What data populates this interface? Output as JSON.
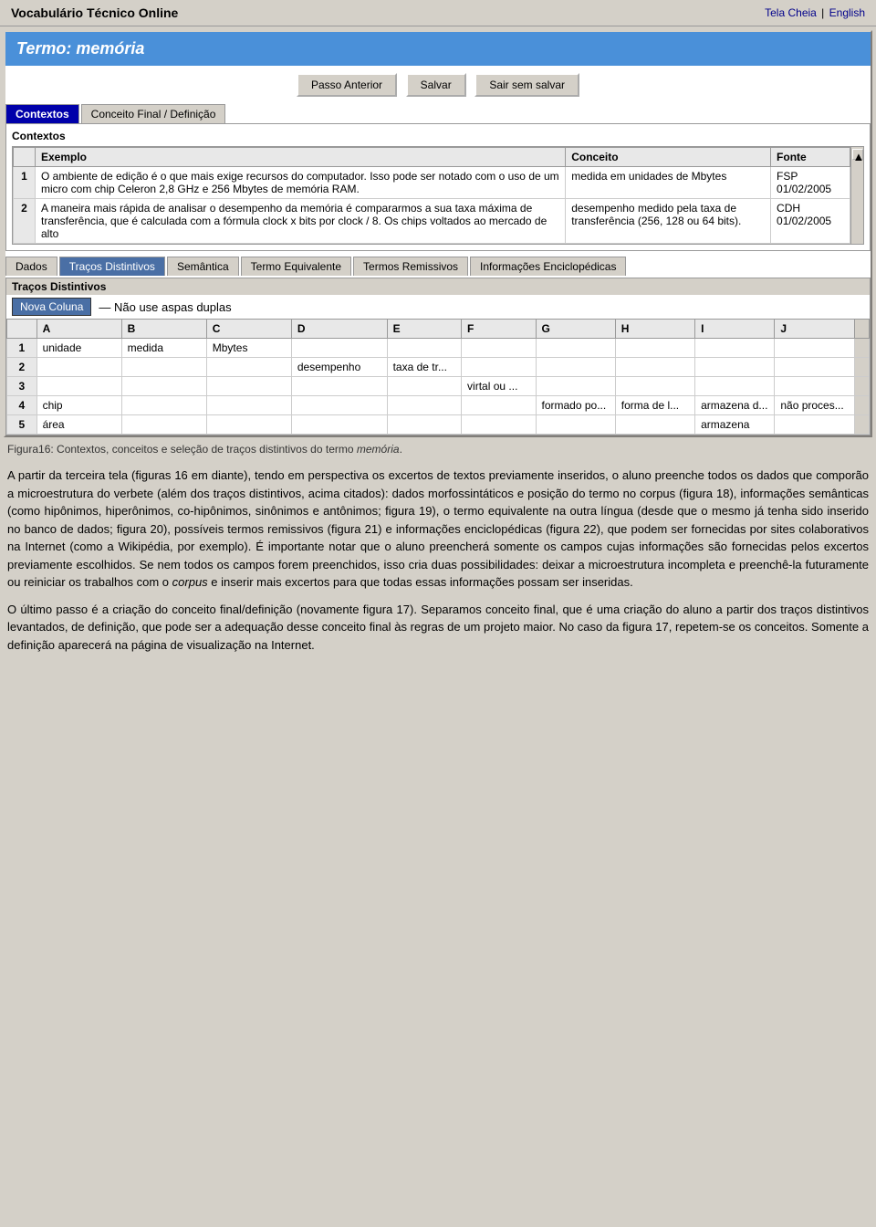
{
  "topBar": {
    "title": "Vocabulário Técnico Online",
    "links": {
      "fullscreen": "Tela Cheia",
      "separator": "|",
      "english": "English"
    }
  },
  "pageTitle": "Termo: memória",
  "buttons": {
    "previous": "Passo Anterior",
    "save": "Salvar",
    "exitNoSave": "Sair sem salvar"
  },
  "tabs1": [
    {
      "label": "Contextos",
      "active": true
    },
    {
      "label": "Conceito Final / Definição",
      "active": false
    }
  ],
  "contextosSection": {
    "title": "Contextos",
    "columns": [
      "Exemplo",
      "Conceito",
      "Fonte"
    ],
    "rows": [
      {
        "num": "1",
        "exemplo": "O ambiente de edição é o que mais exige recursos do computador. Isso pode ser notado com o uso de um micro com chip Celeron 2,8 GHz e 256 Mbytes de memória RAM.",
        "conceito": "medida em unidades de Mbytes",
        "fonte": "FSP 01/02/2005"
      },
      {
        "num": "2",
        "exemplo": "A maneira mais rápida de analisar o desempenho da memória é compararmos a sua taxa máxima de transferência, que é calculada com a fórmula clock x bits por clock / 8. Os chips voltados ao mercado de alto",
        "conceito": "desempenho medido pela taxa de transferência (256, 128 ou 64 bits).",
        "fonte": "CDH 01/02/2005"
      }
    ]
  },
  "tabs2": [
    {
      "label": "Dados",
      "active": false
    },
    {
      "label": "Traços Distintivos",
      "active": true
    },
    {
      "label": "Semântica",
      "active": false
    },
    {
      "label": "Termo Equivalente",
      "active": false
    },
    {
      "label": "Termos Remissivos",
      "active": false
    },
    {
      "label": "Informações Enciclopédicas",
      "active": false
    }
  ],
  "tracosSection": {
    "title": "Traços Distintivos",
    "novaColuna": "Nova Coluna",
    "hint": "— Não use aspas duplas",
    "columns": [
      "",
      "A",
      "B",
      "C",
      "D",
      "E",
      "F",
      "G",
      "H",
      "I",
      "J"
    ],
    "rows": [
      {
        "num": "1",
        "a": "unidade",
        "b": "medida",
        "c": "Mbytes",
        "d": "",
        "e": "",
        "f": "",
        "g": "",
        "h": "",
        "i": "",
        "j": ""
      },
      {
        "num": "2",
        "a": "",
        "b": "",
        "c": "",
        "d": "desempenho",
        "e": "taxa de tr...",
        "f": "",
        "g": "",
        "h": "",
        "i": "",
        "j": ""
      },
      {
        "num": "3",
        "a": "",
        "b": "",
        "c": "",
        "d": "",
        "e": "",
        "f": "virtal ou ...",
        "g": "",
        "h": "",
        "i": "",
        "j": ""
      },
      {
        "num": "4",
        "a": "chip",
        "b": "",
        "c": "",
        "d": "",
        "e": "",
        "f": "",
        "g": "formado po...",
        "h": "forma de l...",
        "i": "armazena d...",
        "j": "não proces..."
      },
      {
        "num": "5",
        "a": "área",
        "b": "",
        "c": "",
        "d": "",
        "e": "",
        "f": "",
        "g": "",
        "h": "",
        "i": "armazena",
        "j": ""
      }
    ]
  },
  "caption": "Figura16: Contextos, conceitos e seleção de traços distintivos do termo memória.",
  "body": {
    "paragraph1": "A partir da terceira tela (figuras 16 em diante), tendo em perspectiva os excertos de textos previamente inseridos, o aluno preenche todos os dados que comporão a microestrutura do verbete (além dos traços distintivos, acima citados): dados morfossintáticos e posição do termo no corpus (figura 18), informações semânticas (como hipônimos, hiperônimos, co-hipônimos, sinônimos e antônimos; figura 19), o termo equivalente na outra língua (desde que o mesmo já tenha sido inserido no banco de dados; figura 20), possíveis termos remissivos (figura 21) e informações enciclopédicas (figura 22), que podem ser fornecidas por sites colaborativos na Internet (como a Wikipédia, por exemplo). É importante notar que o aluno preencherá somente os campos cujas informações são fornecidas pelos excertos previamente escolhidos. Se nem todos os campos forem preenchidos, isso cria duas possibilidades: deixar a microestrutura incompleta e preenchê-la futuramente ou reiniciar os trabalhos com o corpus e inserir mais excertos para que todas essas informações possam ser inseridas.",
    "paragraph2": "O último passo é a criação do conceito final/definição (novamente figura 17). Separamos conceito final, que é uma criação do aluno a partir dos traços distintivos levantados, de definição, que pode ser a adequação desse conceito final às regras de um projeto maior. No caso da figura 17, repetem-se os conceitos. Somente a definição aparecerá na página de visualização na Internet."
  }
}
